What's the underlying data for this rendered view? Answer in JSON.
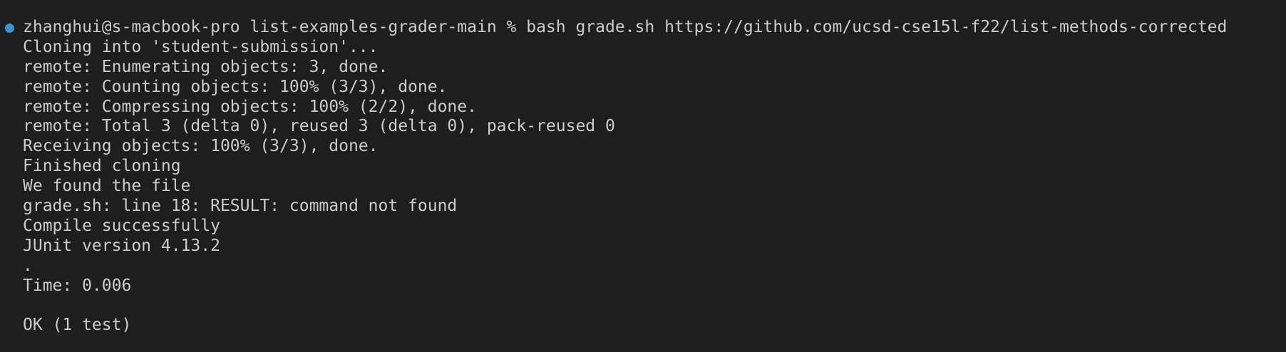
{
  "terminal": {
    "status_indicator_color": "#3794d4",
    "prompt": "zhanghui@s-macbook-pro list-examples-grader-main % ",
    "command": "bash grade.sh https://github.com/ucsd-cse15l-f22/list-methods-corrected",
    "output_lines": [
      "Cloning into 'student-submission'...",
      "remote: Enumerating objects: 3, done.",
      "remote: Counting objects: 100% (3/3), done.",
      "remote: Compressing objects: 100% (2/2), done.",
      "remote: Total 3 (delta 0), reused 3 (delta 0), pack-reused 0",
      "Receiving objects: 100% (3/3), done.",
      "Finished cloning",
      "We found the file",
      "grade.sh: line 18: RESULT: command not found",
      "Compile successfully",
      "JUnit version 4.13.2",
      ".",
      "Time: 0.006",
      "",
      "OK (1 test)"
    ]
  }
}
